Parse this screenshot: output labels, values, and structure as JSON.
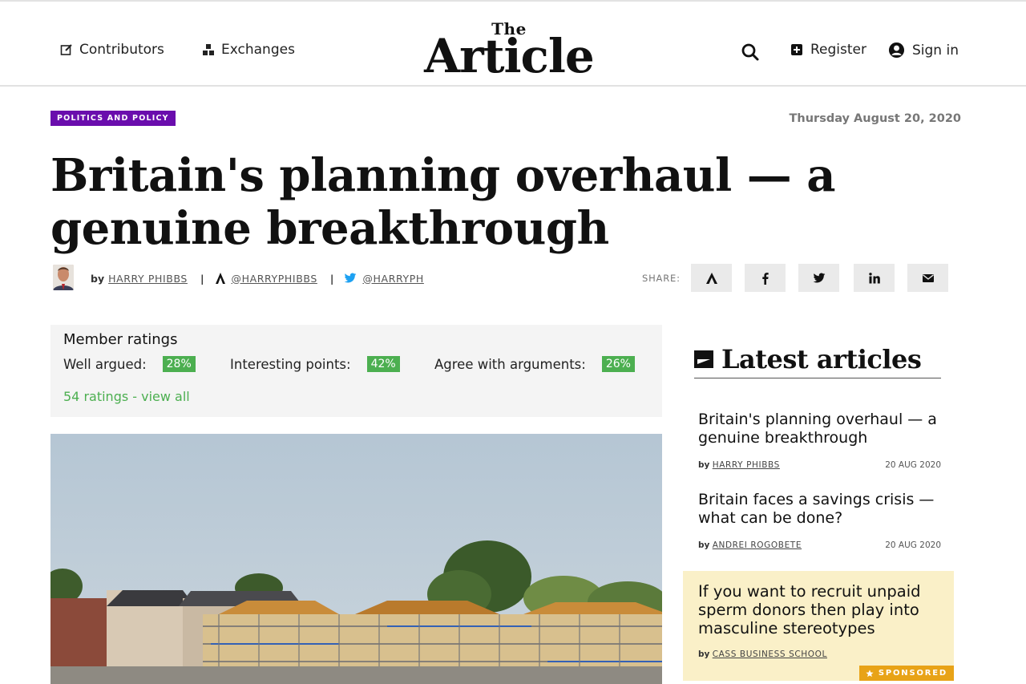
{
  "header": {
    "contributors_label": "Contributors",
    "exchanges_label": "Exchanges",
    "logo_small": "The",
    "logo_main": "Article",
    "register_label": "Register",
    "signin_label": "Sign in"
  },
  "article": {
    "category": "POLITICS AND POLICY",
    "date": "Thursday August 20, 2020",
    "title": "Britain's planning overhaul — a genuine breakthrough",
    "by": "by",
    "author": "HARRY PHIBBS",
    "article_handle": "@HARRYPHIBBS",
    "twitter_handle": "@HARRYPH",
    "share_label": "SHARE:"
  },
  "ratings": {
    "title": "Member ratings",
    "items": [
      {
        "label": "Well argued:",
        "value": "28%"
      },
      {
        "label": "Interesting points:",
        "value": "42%"
      },
      {
        "label": "Agree with arguments:",
        "value": "26%"
      }
    ],
    "view_all": "54 ratings - view all"
  },
  "sidebar": {
    "heading": "Latest articles",
    "articles": [
      {
        "title": "Britain's planning overhaul — a genuine breakthrough",
        "by": "by",
        "author": "HARRY PHIBBS",
        "date": "20 AUG 2020"
      },
      {
        "title": "Britain faces a savings crisis — what can be done?",
        "by": "by",
        "author": "ANDREI ROGOBETE",
        "date": "20 AUG 2020"
      }
    ],
    "sponsored": {
      "title": "If you want to recruit unpaid sperm donors then play into masculine stereotypes",
      "by": "by",
      "author": "CASS BUSINESS SCHOOL",
      "badge": "SPONSORED"
    }
  },
  "colors": {
    "category_bg": "#6a0dad",
    "rating_green": "#4caf50",
    "sponsored_bg": "#faf0c8",
    "sponsored_badge": "#e8a317",
    "twitter_blue": "#1da1f2"
  }
}
